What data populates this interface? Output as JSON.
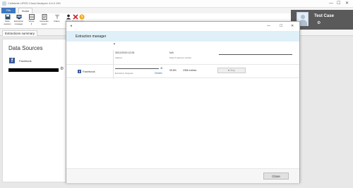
{
  "app": {
    "title": "Cellebrite UFED Cloud Analyzer 4.6.0.190"
  },
  "window_controls": {
    "minimize": "—",
    "maximize": "☐",
    "close": "✕"
  },
  "ribbon": {
    "tabs": [
      "File",
      "Home"
    ],
    "buttons": [
      {
        "label": "Save\nsession",
        "icon": "save-icon"
      },
      {
        "label": "Extraction\nmanager",
        "icon": "extraction-icon"
      },
      {
        "label": "Views\n▾",
        "icon": "views-icon"
      },
      {
        "label": "Generate\nreport",
        "icon": "report-icon"
      },
      {
        "label": "Filters",
        "icon": "filter-icon"
      },
      {
        "label": "Users",
        "icon": "users-icon"
      },
      {
        "label": "Cancel",
        "icon": "cancel-icon"
      },
      {
        "label": "Help",
        "icon": "help-icon"
      }
    ]
  },
  "profile": {
    "case_name": "Test Case",
    "gear": "⚙"
  },
  "doc_tabs": {
    "active": "Extractions summary"
  },
  "data_sources": {
    "title": "Data Sources",
    "items": [
      {
        "name": "Facebook",
        "gear": "⚙"
      }
    ]
  },
  "modal": {
    "title": "Extraction manager",
    "back": "◄",
    "controls": {
      "minimize": "—",
      "maximize": "☐",
      "close": "✕"
    },
    "rows": [
      {
        "timestamp": "30/12/2015 12:05",
        "status": "Started",
        "search_value": "N/A",
        "search_label": "Search warrant number",
        "progress": 1.0
      },
      {
        "source": "Facebook",
        "status": "Extraction Stopped",
        "details_link": "Details",
        "percent": "99.8%",
        "entries": "2365 entries",
        "stop_label": "Stop",
        "progress": 0.998
      }
    ],
    "scroll_indicator": "▲",
    "close_button": "Close"
  },
  "colors": {
    "accent": "#3c78c0",
    "modal_header": "#dff0f8",
    "facebook": "#3b5998",
    "link": "#2a7ccf"
  }
}
